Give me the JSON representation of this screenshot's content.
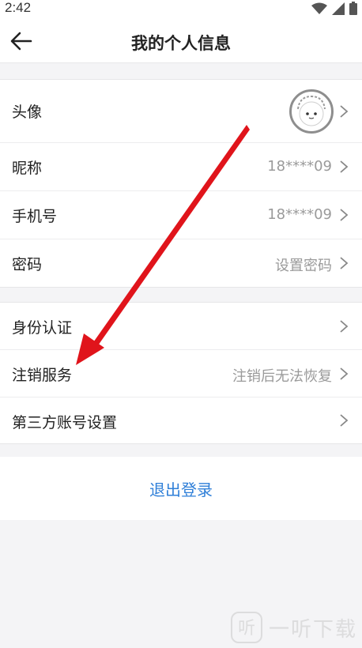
{
  "status_bar": {
    "time": "2:42"
  },
  "header": {
    "title": "我的个人信息"
  },
  "groups": [
    {
      "rows": [
        {
          "label": "头像",
          "value": ""
        },
        {
          "label": "昵称",
          "value": "18****09"
        },
        {
          "label": "手机号",
          "value": "18****09"
        },
        {
          "label": "密码",
          "value": "设置密码"
        }
      ]
    },
    {
      "rows": [
        {
          "label": "身份认证",
          "value": ""
        },
        {
          "label": "注销服务",
          "value": "注销后无法恢复"
        },
        {
          "label": "第三方账号设置",
          "value": ""
        }
      ]
    }
  ],
  "logout": {
    "label": "退出登录"
  },
  "watermark": {
    "text": "一听下载"
  },
  "colors": {
    "accent": "#2f7fd8",
    "annotation_arrow": "#e0141b"
  }
}
